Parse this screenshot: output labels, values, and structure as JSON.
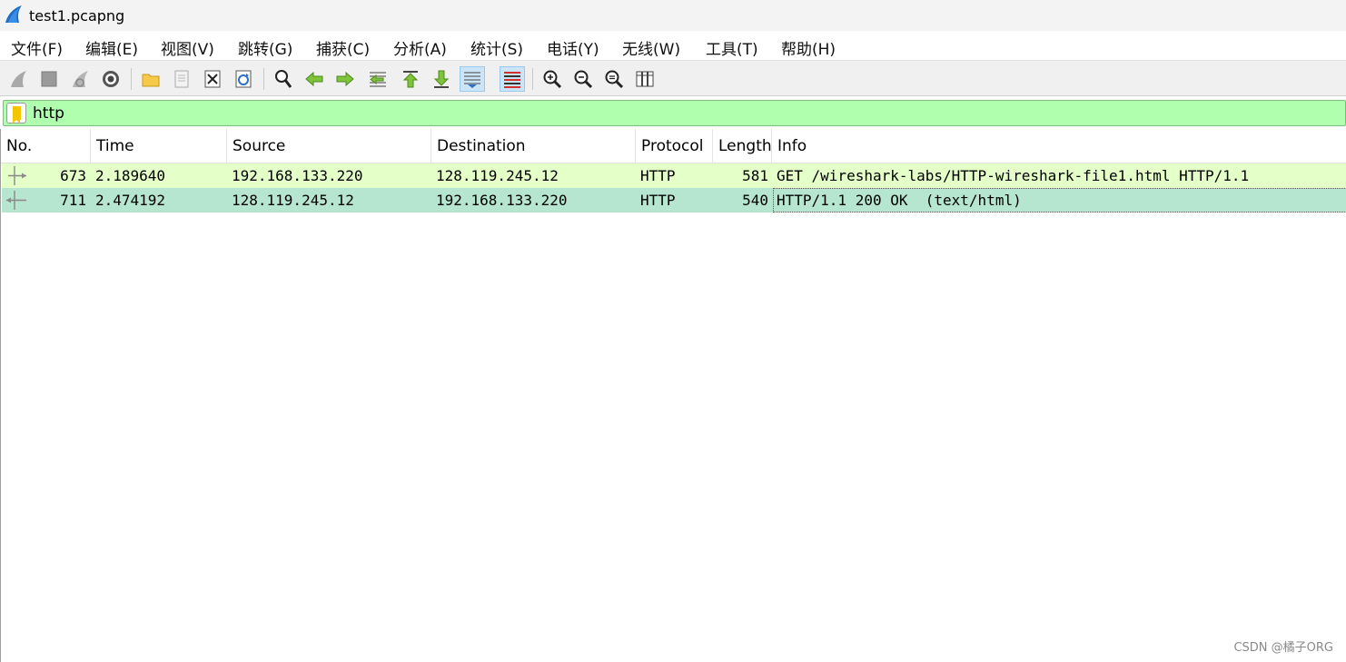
{
  "window": {
    "title": "test1.pcapng"
  },
  "menu": [
    "文件(F)",
    "编辑(E)",
    "视图(V)",
    "跳转(G)",
    "捕获(C)",
    "分析(A)",
    "统计(S)",
    "电话(Y)",
    "无线(W)",
    "工具(T)",
    "帮助(H)"
  ],
  "toolbar": {
    "icons": [
      "start-capture-icon",
      "stop-capture-icon",
      "restart-capture-icon",
      "capture-options-icon",
      "open-file-icon",
      "save-file-icon",
      "close-file-icon",
      "reload-file-icon",
      "find-packet-icon",
      "go-back-icon",
      "go-forward-icon",
      "go-to-packet-icon",
      "first-packet-icon",
      "last-packet-icon",
      "autoscroll-icon",
      "colorize-icon",
      "zoom-in-icon",
      "zoom-out-icon",
      "normal-size-icon",
      "resize-columns-icon"
    ],
    "active": [
      "autoscroll-icon",
      "colorize-icon"
    ]
  },
  "filter": {
    "value": "http"
  },
  "packet_list": {
    "columns": [
      "No.",
      "Time",
      "Source",
      "Destination",
      "Protocol",
      "Length",
      "Info"
    ],
    "rows": [
      {
        "no": "673",
        "time": "2.189640",
        "source": "192.168.133.220",
        "destination": "128.119.245.12",
        "protocol": "HTTP",
        "length": "581",
        "info": "GET /wireshark-labs/HTTP-wireshark-file1.html HTTP/1.1",
        "direction": "request",
        "color": "#e4ffc7"
      },
      {
        "no": "711",
        "time": "2.474192",
        "source": "128.119.245.12",
        "destination": "192.168.133.220",
        "protocol": "HTTP",
        "length": "540",
        "info": "HTTP/1.1 200 OK  (text/html)",
        "direction": "response",
        "color": "#b7e6d0"
      }
    ]
  },
  "watermark": "CSDN @橘子ORG"
}
